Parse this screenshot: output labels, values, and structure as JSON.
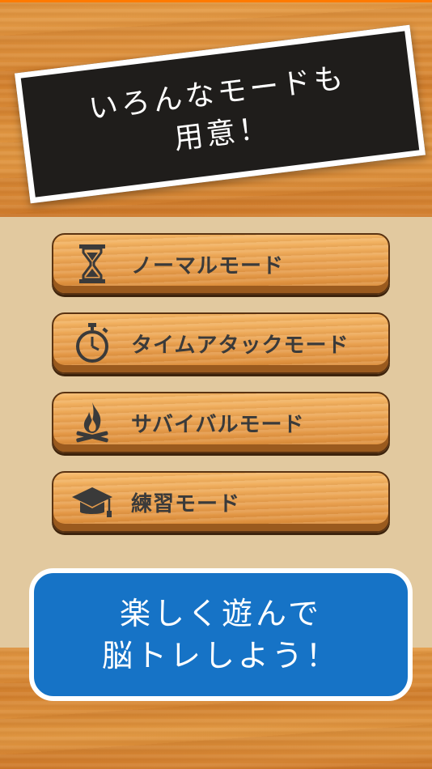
{
  "banner": {
    "text": "いろんなモードも\n用意！"
  },
  "modes": [
    {
      "label": "ノーマルモード",
      "icon": "hourglass-icon"
    },
    {
      "label": "タイムアタックモード",
      "icon": "stopwatch-icon"
    },
    {
      "label": "サバイバルモード",
      "icon": "campfire-icon"
    },
    {
      "label": "練習モード",
      "icon": "graduation-cap-icon"
    }
  ],
  "callout": {
    "text": "楽しく遊んで\n脳トレしよう！"
  },
  "colors": {
    "accent_blue": "#1673c6",
    "banner_black": "#1f1d1b",
    "panel_beige": "#e2c99f",
    "wood": "#d9893a"
  }
}
